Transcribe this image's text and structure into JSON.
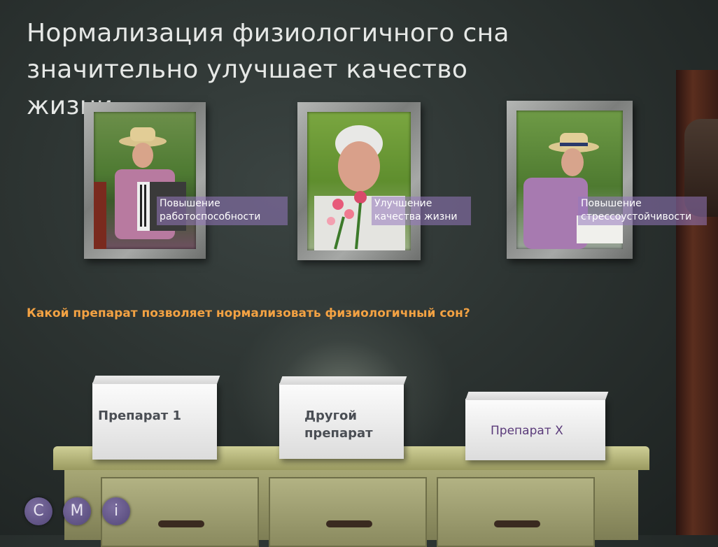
{
  "title": "Нормализация физиологичного сна значительно улучшает качество жизни",
  "photos": [
    {
      "caption_line1": "Повышение",
      "caption_line2": "работоспособности"
    },
    {
      "caption_line1": "Улучшение",
      "caption_line2": "качества жизни"
    },
    {
      "caption_line1": "Повышение",
      "caption_line2": "стрессоустойчивости"
    }
  ],
  "question": "Какой препарат позволяет нормализовать физиологичный сон?",
  "boxes": [
    {
      "label": "Препарат 1"
    },
    {
      "label_line1": "Другой",
      "label_line2": "препарат"
    },
    {
      "label": "Препарат X"
    }
  ],
  "nav": {
    "c": "C",
    "m": "M",
    "i": "i"
  },
  "colors": {
    "question": "#f3a243",
    "caption_bg": "#9678be",
    "nav_button": "#6a5d8e",
    "box_x_text": "#5a3a7a"
  }
}
